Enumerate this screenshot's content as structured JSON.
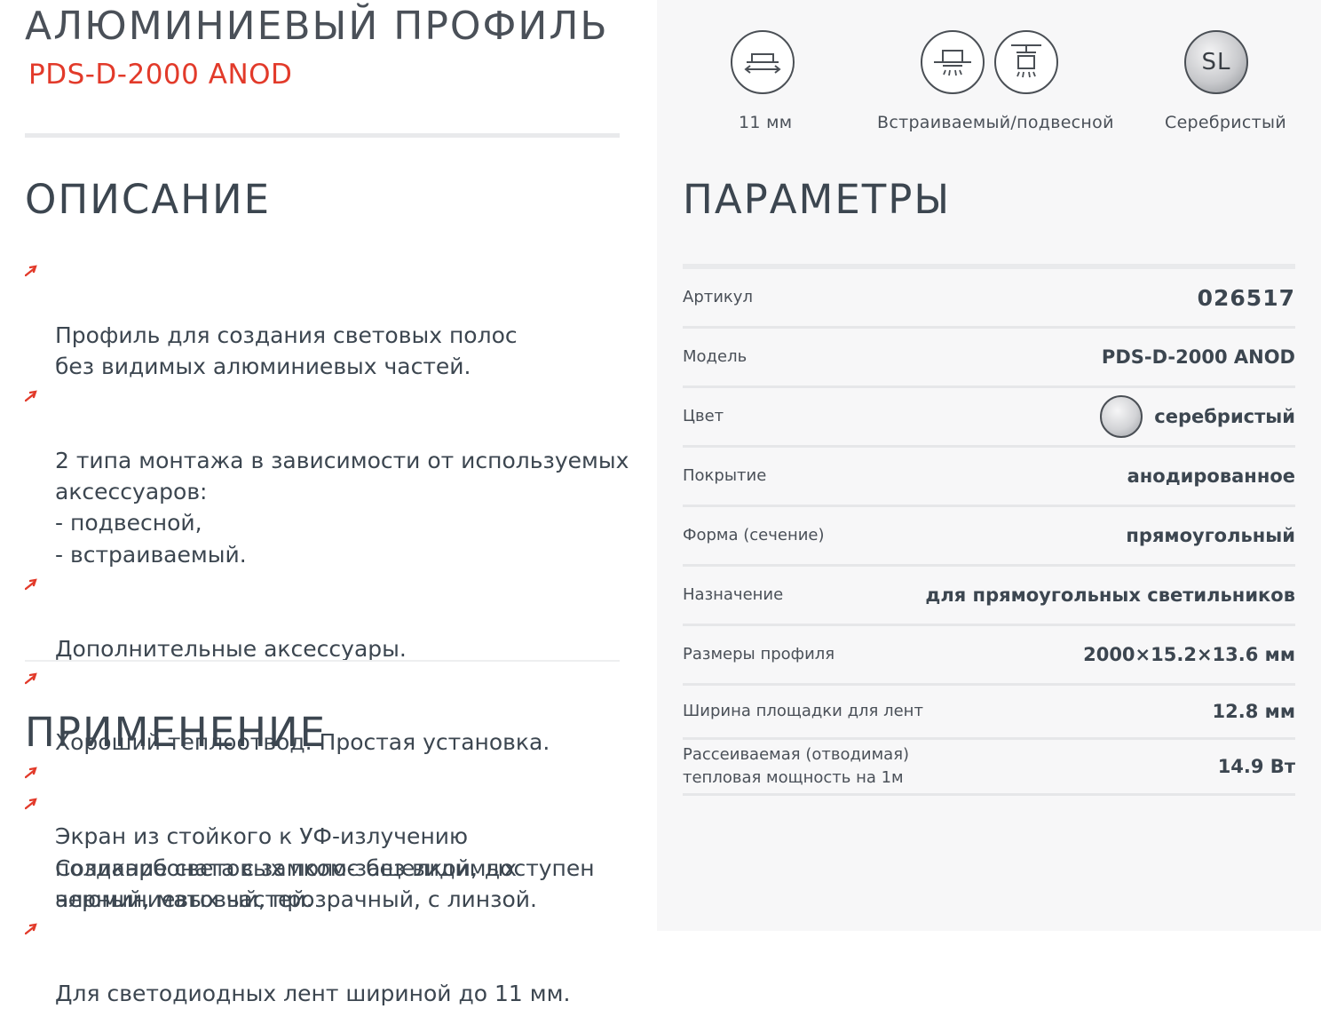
{
  "header": {
    "title": "АЛЮМИНИЕВЫЙ ПРОФИЛЬ",
    "model": "PDS-D-2000 ANOD"
  },
  "description": {
    "heading": "ОПИСАНИЕ",
    "items": [
      "Профиль для создания световых полос\n без видимых алюминиевых частей.",
      "2 типа монтажа в зависимости от используемых\nаксессуаров:\n- подвесной,\n- встраиваемый.",
      "Дополнительные аксессуары.",
      "Хороший теплоотвод. Простая установка.",
      "Экран из стойкого к УФ-излучению\nполикарбоната с замком-защелкой, доступен\nчерный, матовый, прозрачный, с линзой."
    ]
  },
  "application": {
    "heading": "ПРИМЕНЕНИЕ",
    "items": [
      "Создание световых полос без видимых\nалюминиевых частей.",
      "Для светодиодных лент шириной до 11 мм."
    ]
  },
  "features": [
    {
      "icon": "width-arrows-icon",
      "label": "11 мм"
    },
    {
      "icon": "built-in-mount-icon",
      "label": ""
    },
    {
      "icon": "pendant-mount-icon",
      "label": "Встраиваемый/подвесной"
    },
    {
      "icon": "silver-color-icon",
      "badge": "SL",
      "label": "Серебристый"
    }
  ],
  "params": {
    "heading": "ПАРАМЕТРЫ",
    "rows": [
      {
        "label": "Артикул",
        "value": "026517"
      },
      {
        "label": "Модель",
        "value": "PDS-D-2000 ANOD"
      },
      {
        "label": "Цвет",
        "value": "серебристый"
      },
      {
        "label": "Покрытие",
        "value": "анодированное"
      },
      {
        "label": "Форма (сечение)",
        "value": "прямоугольный"
      },
      {
        "label": "Назначение",
        "value": "для прямоугольных светильников"
      },
      {
        "label": "Размеры профиля",
        "value": "2000×15.2×13.6 мм"
      },
      {
        "label": "Ширина площадки для лент",
        "value": "12.8 мм"
      },
      {
        "label": "Рассеиваемая (отводимая)\nтепловая мощность на 1м",
        "value": "14.9 Вт"
      }
    ]
  },
  "colors": {
    "accent": "#e23a2a",
    "text": "#3c4650",
    "panel": "#f7f7f8"
  }
}
